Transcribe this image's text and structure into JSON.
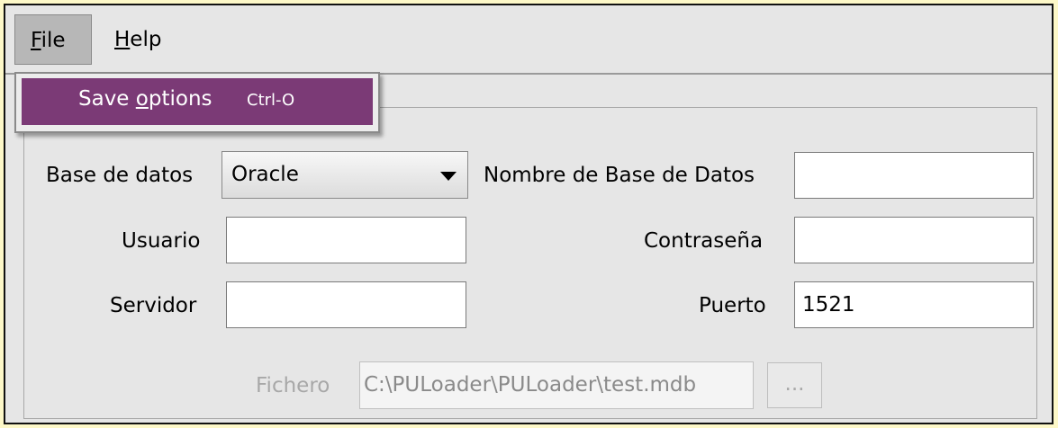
{
  "menubar": {
    "file": {
      "label": "File",
      "mnemonic": "F",
      "rest": "ile"
    },
    "help": {
      "label": "Help",
      "mnemonic": "H",
      "rest": "elp"
    }
  },
  "file_menu": {
    "items": [
      {
        "label_before": "Save ",
        "mnemonic": "o",
        "label_after": "ptions",
        "accelerator": "Ctrl-O"
      }
    ]
  },
  "form": {
    "base_datos": {
      "label": "Base de datos",
      "value": "Oracle"
    },
    "nombre_bd": {
      "label": "Nombre de Base de Datos",
      "value": ""
    },
    "usuario": {
      "label": "Usuario",
      "value": ""
    },
    "contrasena": {
      "label": "Contraseña",
      "value": ""
    },
    "servidor": {
      "label": "Servidor",
      "value": ""
    },
    "puerto": {
      "label": "Puerto",
      "value": "1521"
    },
    "fichero": {
      "label": "Fichero",
      "value": "C:\\PULoader\\PULoader\\test.mdb"
    },
    "browse_label": "..."
  },
  "colors": {
    "menu_highlight": "#7b3a76",
    "background": "#fdf8c8",
    "window": "#e6e6e6"
  }
}
